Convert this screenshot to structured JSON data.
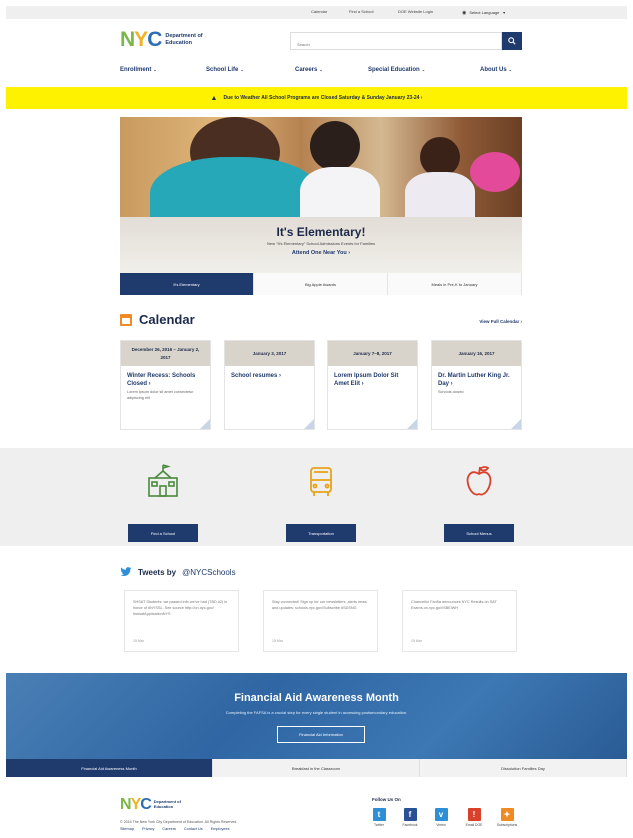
{
  "utility": {
    "links": [
      "Calendar",
      "Find a School",
      "DOE Website Login"
    ],
    "language": "Select Language"
  },
  "header": {
    "logo_letters": [
      "N",
      "Y",
      "C"
    ],
    "logo_dept": "Department of Education",
    "search_placeholder": "Search"
  },
  "nav": {
    "items": [
      "Enrollment",
      "School Life",
      "Careers",
      "Special Education",
      "About Us"
    ]
  },
  "alert": {
    "text": "Due to Weather All School Programs are Closed Saturday & Sunday January 23-24 ›"
  },
  "hero": {
    "title": "It's Elementary!",
    "subtitle": "New \"It's Elementary\" School Admissions Events for Families",
    "link": "Attend One Near You ›",
    "tabs": [
      "It's Elementary",
      "Big Apple Awards",
      "Meals in Pre-K to January"
    ],
    "active_tab": 0
  },
  "calendar": {
    "title": "Calendar",
    "view_all": "View Full Calendar ›",
    "events": [
      {
        "date": "December 26, 2016 – January 2, 2017",
        "title": "Winter Recess: Schools Closed ›",
        "desc": "Lorem ipsum dolor sit amet consectetur adipiscing elit"
      },
      {
        "date": "January 3, 2017",
        "title": "School resumes ›",
        "desc": ""
      },
      {
        "date": "January 7–8, 2017",
        "title": "Lorem Ipsum Dolor Sit Amet Elit ›",
        "desc": ""
      },
      {
        "date": "January 16, 2017",
        "title": "Dr. Martin Luther King Jr. Day ›",
        "desc": "Schools closed"
      }
    ]
  },
  "quick_links": [
    {
      "label": "Find a School",
      "icon": "school-building-icon",
      "color": "#4a8a3c"
    },
    {
      "label": "Transportation",
      "icon": "school-bus-icon",
      "color": "#e8a21a"
    },
    {
      "label": "School Menus",
      "icon": "apple-icon",
      "color": "#d9412b"
    }
  ],
  "tweets": {
    "title": "Tweets by",
    "handle": "@NYCSchools",
    "items": [
      {
        "text": "SHSAT Students: we passed info we've had (TBD #2) in honor of #NYSSL. See source http://on.nyc.gov/ #shsatApplicationNYS",
        "time": "15 Mar"
      },
      {
        "text": "Stay connected! Sign up for our newsletters, alerts news and updates: schools.nyc.gov/Subscribe #SDSNG",
        "time": "15 Mar"
      },
      {
        "text": "Chancellor Fariña announces NYC Results on SAT Exams on.nyc.gov/SBEIWH",
        "time": "15 Mar"
      }
    ]
  },
  "promo": {
    "title": "Financial Aid Awareness Month",
    "subtitle": "Completing the FAFSA is a crucial step for every single student in accessing postsecondary education.",
    "button": "Financial Aid Information",
    "tabs": [
      "Financial Aid Awareness Month",
      "Breakfast in the Classroom",
      "Dissolution Families Day"
    ],
    "active_tab": 0
  },
  "footer": {
    "logo_letters": [
      "N",
      "Y",
      "C"
    ],
    "logo_dept": "Department of Education",
    "copyright": "© 2016 The New York City Department of Education. All Rights Reserved.",
    "links": [
      "Sitemap",
      "Privacy",
      "Careers",
      "Contact Us",
      "Employees"
    ],
    "follow": "Follow Us On",
    "social": [
      {
        "name": "Twitter",
        "glyph": "t",
        "color": "#2f8fd6"
      },
      {
        "name": "Facebook",
        "glyph": "f",
        "color": "#2a5196"
      },
      {
        "name": "Vimeo",
        "glyph": "v",
        "color": "#2f8fd6"
      },
      {
        "name": "Email DOE",
        "glyph": "!",
        "color": "#d9412b"
      },
      {
        "name": "Subscriptions",
        "glyph": "✦",
        "color": "#f08a24"
      }
    ]
  },
  "colors": {
    "navy": "#1f3a6d",
    "alert_yellow": "#fff200",
    "nyc_green": "#7ab648",
    "nyc_blue": "#2e6db4"
  }
}
